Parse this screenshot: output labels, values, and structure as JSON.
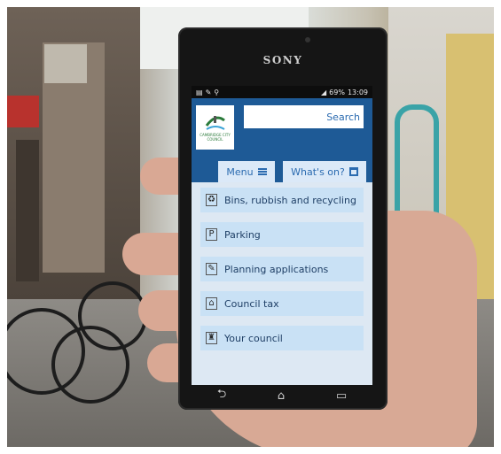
{
  "phone": {
    "brand": "SONY",
    "status_time": "13:09",
    "status_battery": "69%"
  },
  "site": {
    "logo_text": "CAMBRIDGE CITY COUNCIL",
    "search_label": "Search",
    "menu_label": "Menu",
    "whats_on_label": "What's on?"
  },
  "menu_items": [
    {
      "label": "Bins, rubbish and recycling",
      "icon": "bin-icon"
    },
    {
      "label": "Parking",
      "icon": "parking-icon"
    },
    {
      "label": "Planning applications",
      "icon": "planning-icon"
    },
    {
      "label": "Council tax",
      "icon": "house-icon"
    },
    {
      "label": "Your council",
      "icon": "building-icon"
    }
  ],
  "nav": {
    "back": "⮌",
    "home": "⌂",
    "recent": "▭"
  },
  "colors": {
    "header_blue": "#1e5a96",
    "item_blue": "#c9e1f5",
    "link_blue": "#2b6bb0"
  }
}
